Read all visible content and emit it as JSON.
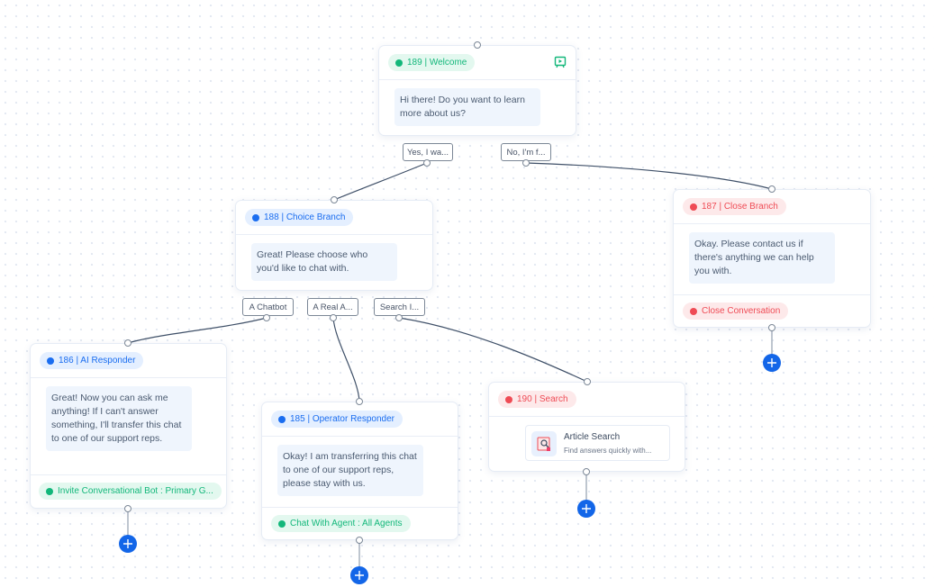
{
  "nodes": {
    "welcome": {
      "label": "189 | Welcome",
      "message": "Hi there! Do you want to learn more about us?",
      "icon": "bot-preview-icon",
      "choices": [
        "Yes, I wa...",
        "No, I'm f..."
      ]
    },
    "choice_branch": {
      "label": "188 | Choice Branch",
      "message": "Great! Please choose who you'd like to chat with.",
      "choices": [
        "A Chatbot",
        "A Real A...",
        "Search I..."
      ]
    },
    "close_branch": {
      "label": "187 | Close Branch",
      "message": "Okay. Please contact us if there's anything we can help you with.",
      "action": "Close Conversation"
    },
    "ai_responder": {
      "label": "186 | AI Responder",
      "message": "Great! Now you can ask me anything! If I can't answer something, I'll transfer this chat to one of our support reps.",
      "action": "Invite Conversational Bot : Primary G..."
    },
    "operator_responder": {
      "label": "185 | Operator Responder",
      "message": "Okay! I am transferring this chat to one of our support reps, please stay with us.",
      "action": "Chat With Agent : All Agents"
    },
    "search": {
      "label": "190 | Search",
      "card_title": "Article Search",
      "card_description": "Find answers quickly with..."
    }
  },
  "colors": {
    "green": "#12b77a",
    "blue": "#1a6df0",
    "red": "#ef4b55",
    "add_button": "#1366e8"
  }
}
